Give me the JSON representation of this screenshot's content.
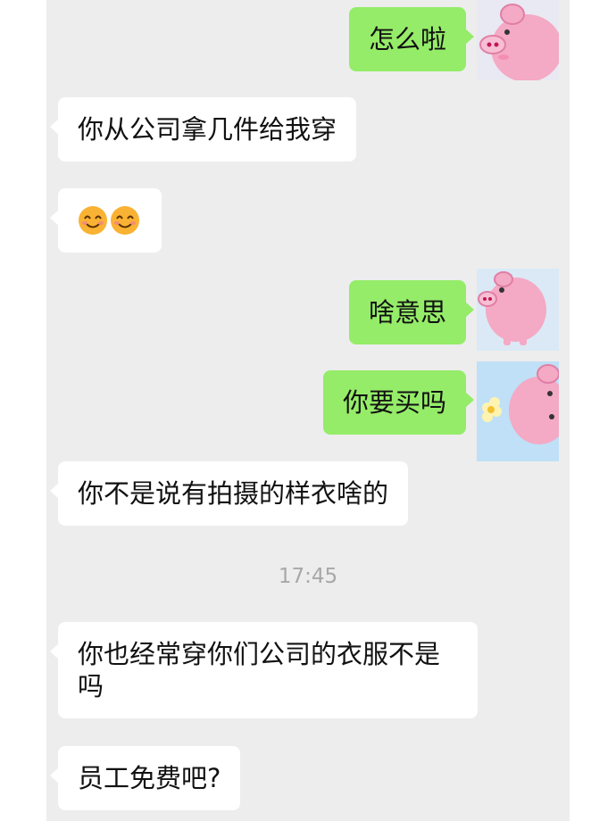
{
  "messages": [
    {
      "side": "out",
      "text": "怎么啦"
    },
    {
      "side": "in",
      "text": "你从公司拿几件给我穿"
    },
    {
      "side": "in",
      "emoji": [
        "smiling-face-emoji",
        "smiling-face-emoji"
      ]
    },
    {
      "side": "out",
      "text": "啥意思"
    },
    {
      "side": "out",
      "text": "你要买吗"
    },
    {
      "side": "in",
      "text": "你不是说有拍摄的样衣啥的"
    },
    {
      "side": "in",
      "text": "你也经常穿你们公司的衣服不是吗"
    },
    {
      "side": "in",
      "text": "员工免费吧?"
    }
  ],
  "timestamp": "17:45",
  "colors": {
    "background": "#ededed",
    "incoming_bubble": "#ffffff",
    "outgoing_bubble": "#95ec69",
    "timestamp_text": "#a8a8a8"
  },
  "avatar": {
    "icon": "pink-pig-avatar-icon"
  }
}
